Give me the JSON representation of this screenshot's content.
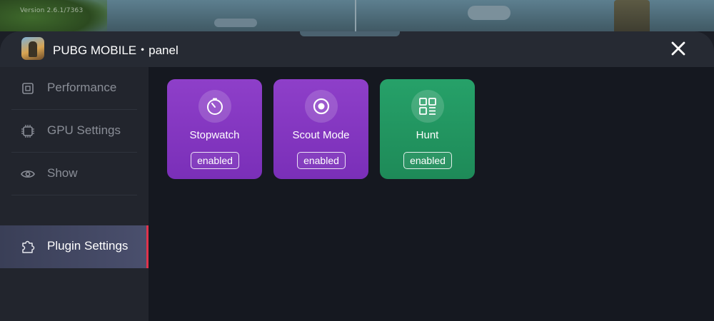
{
  "background": {
    "version_text": "Version 2.6.1/7363"
  },
  "header": {
    "app_name": "PUBG MOBILE・panel",
    "app_icon": "pubg-app-icon",
    "close_icon": "close-icon"
  },
  "sidebar": {
    "items": [
      {
        "label": "Performance",
        "icon": "chip-icon",
        "active": false
      },
      {
        "label": "GPU Settings",
        "icon": "gpu-chip-icon",
        "active": false
      },
      {
        "label": "Show",
        "icon": "eye-icon",
        "active": false
      },
      {
        "label": "Plugin Settings",
        "icon": "puzzle-icon",
        "active": true
      }
    ]
  },
  "plugins": [
    {
      "name": "Stopwatch",
      "status": "enabled",
      "icon": "stopwatch-icon",
      "color": "#8e3fc9"
    },
    {
      "name": "Scout Mode",
      "status": "enabled",
      "icon": "scout-target-icon",
      "color": "#8e3fc9"
    },
    {
      "name": "Hunt",
      "status": "enabled",
      "icon": "hunt-grid-icon",
      "color": "#26a169"
    }
  ],
  "colors": {
    "active_accent": "#e0324b",
    "panel_bg": "#151820",
    "sidebar_bg": "#22252d"
  }
}
